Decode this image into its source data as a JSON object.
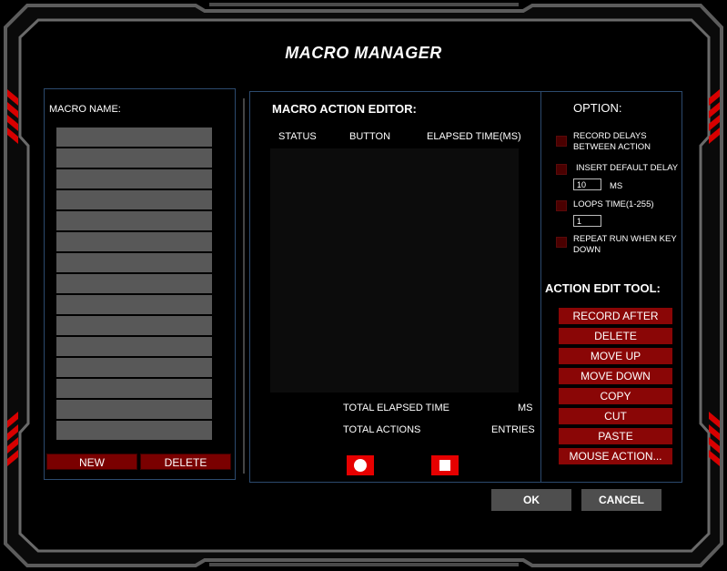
{
  "window": {
    "title": "MACRO MANAGER"
  },
  "macro_list": {
    "label": "MACRO NAME:",
    "rows": [
      "",
      "",
      "",
      "",
      "",
      "",
      "",
      "",
      "",
      "",
      "",
      "",
      "",
      "",
      ""
    ],
    "new_label": "NEW",
    "delete_label": "DELETE"
  },
  "editor": {
    "title": "MACRO ACTION EDITOR:",
    "columns": [
      "STATUS",
      "BUTTON",
      "ELAPSED TIME(MS)"
    ],
    "total_elapsed_label": "TOTAL ELAPSED TIME",
    "total_elapsed_unit": "MS",
    "total_actions_label": "TOTAL ACTIONS",
    "total_actions_unit": "ENTRIES"
  },
  "options": {
    "title": "OPTION:",
    "record_delays": "RECORD DELAYS BETWEEN ACTION",
    "insert_default_delay": "INSERT DEFAULT DELAY",
    "default_delay_value": "10",
    "default_delay_unit": "MS",
    "loops_label": "LOOPS TIME(1-255)",
    "loops_value": "1",
    "repeat_run": "REPEAT RUN WHEN KEY DOWN"
  },
  "tools": {
    "title": "ACTION EDIT TOOL:",
    "buttons": [
      "RECORD AFTER",
      "DELETE",
      "MOVE UP",
      "MOVE DOWN",
      "COPY",
      "CUT",
      "PASTE",
      "MOUSE ACTION..."
    ]
  },
  "footer": {
    "ok_label": "OK",
    "cancel_label": "CANCEL"
  },
  "colors": {
    "accent_red": "#e60000",
    "panel_border": "#2c4a6e",
    "frame_gray": "#6a6a6a"
  }
}
